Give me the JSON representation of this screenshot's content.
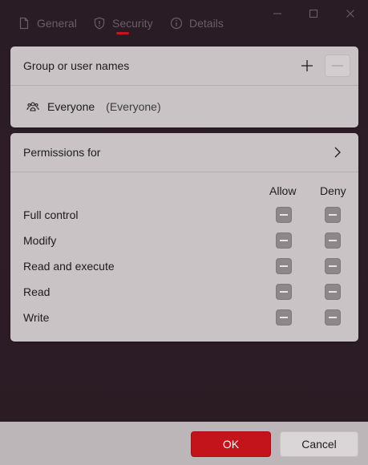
{
  "tabs": [
    {
      "label": "General",
      "icon": "document-icon"
    },
    {
      "label": "Security",
      "icon": "shield-icon",
      "selected": true
    },
    {
      "label": "Details",
      "icon": "info-icon"
    }
  ],
  "group_section": {
    "title": "Group or user names",
    "users": [
      {
        "name": "Everyone",
        "detail": "(Everyone)",
        "icon": "group-icon"
      }
    ]
  },
  "permissions_section": {
    "title": "Permissions for",
    "columns": {
      "allow": "Allow",
      "deny": "Deny"
    },
    "rows": [
      {
        "label": "Full control",
        "allow": "indeterminate",
        "deny": "indeterminate"
      },
      {
        "label": "Modify",
        "allow": "indeterminate",
        "deny": "indeterminate"
      },
      {
        "label": "Read and execute",
        "allow": "indeterminate",
        "deny": "indeterminate"
      },
      {
        "label": "Read",
        "allow": "indeterminate",
        "deny": "indeterminate"
      },
      {
        "label": "Write",
        "allow": "indeterminate",
        "deny": "indeterminate"
      }
    ]
  },
  "footer": {
    "ok_label": "OK",
    "cancel_label": "Cancel"
  },
  "colors": {
    "accent": "#c4141b",
    "background": "#2b1c24",
    "card": "#c9c3c6"
  }
}
